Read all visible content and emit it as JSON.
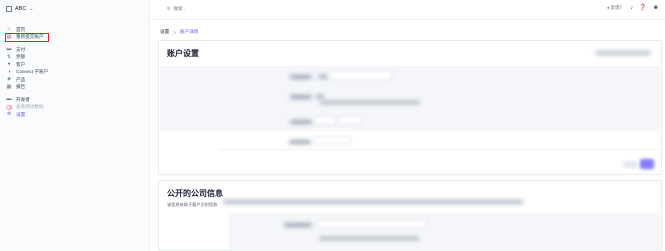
{
  "account": {
    "name": "ABC"
  },
  "sidebar": {
    "items": [
      {
        "icon": "home-icon",
        "label": "首页"
      },
      {
        "icon": "account-icon",
        "label": "重新提交账户"
      },
      {
        "icon": "payment-icon",
        "label": "支付"
      },
      {
        "icon": "balance-icon",
        "label": "余额"
      },
      {
        "icon": "customer-icon",
        "label": "客户"
      },
      {
        "icon": "connect-icon",
        "label": "Connect 子账户"
      },
      {
        "icon": "product-icon",
        "label": "产品"
      },
      {
        "icon": "report-icon",
        "label": "报告"
      },
      {
        "icon": "developer-icon",
        "label": "开发者"
      },
      {
        "icon": "toggle-icon",
        "label": "查看测试数据"
      },
      {
        "icon": "gear-icon",
        "label": "设置"
      }
    ]
  },
  "topbar": {
    "search_placeholder": "搜索...",
    "feedback_label": "反馈？"
  },
  "breadcrumb": {
    "root": "设置",
    "separator": ">",
    "current": "账户详情"
  },
  "card1": {
    "title": "账户设置"
  },
  "card2": {
    "title": "公开的公司信息",
    "subtitle": "该信息有助于客户识别您和"
  },
  "colors": {
    "accent": "#635bff",
    "highlight_border": "#d9232e"
  }
}
